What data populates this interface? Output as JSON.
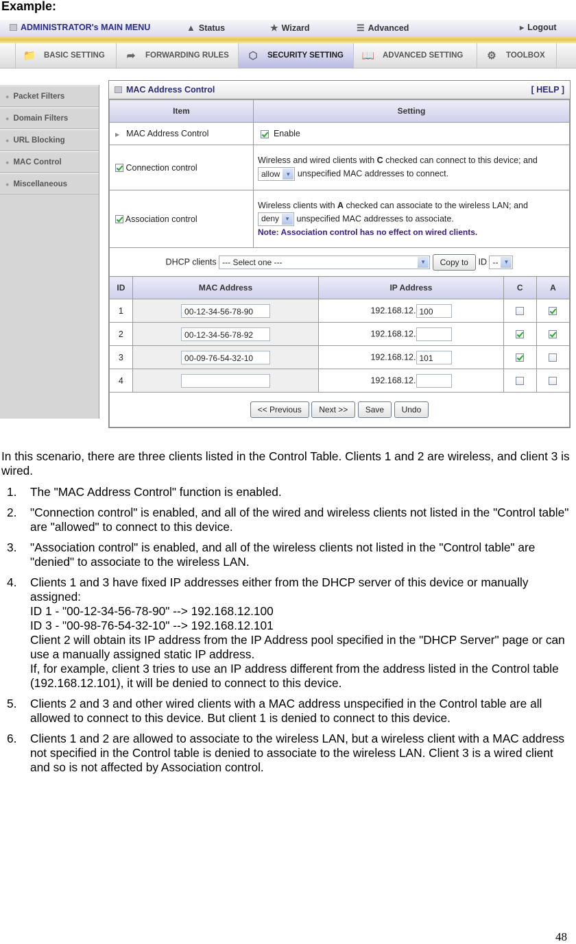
{
  "heading": "Example:",
  "ui": {
    "topbar": {
      "admin_menu": "ADMINISTRATOR's MAIN MENU",
      "items": [
        {
          "label": "Status",
          "icon": "status-icon"
        },
        {
          "label": "Wizard",
          "icon": "wizard-icon"
        },
        {
          "label": "Advanced",
          "icon": "advanced-icon"
        },
        {
          "label": "Logout",
          "icon": "arrow-right-icon"
        }
      ]
    },
    "nav_tabs": [
      {
        "label": "BASIC SETTING",
        "icon": "folder-icon",
        "active": false
      },
      {
        "label": "FORWARDING RULES",
        "icon": "forwarding-icon",
        "active": false
      },
      {
        "label": "SECURITY SETTING",
        "icon": "nut-icon",
        "active": true
      },
      {
        "label": "ADVANCED SETTING",
        "icon": "book-icon",
        "active": false
      },
      {
        "label": "TOOLBOX",
        "icon": "toolbox-icon",
        "active": false
      }
    ],
    "sidebar": {
      "items": [
        {
          "label": "Packet Filters"
        },
        {
          "label": "Domain Filters"
        },
        {
          "label": "URL Blocking"
        },
        {
          "label": "MAC Control"
        },
        {
          "label": "Miscellaneous"
        }
      ]
    },
    "panel": {
      "title": "MAC Address Control",
      "help": "[ HELP ]",
      "headers": {
        "item": "Item",
        "setting": "Setting"
      },
      "mac_control": {
        "label": "MAC Address Control",
        "checkbox_label": "Enable",
        "checked": true
      },
      "connection": {
        "label": "Connection control",
        "checked": true,
        "desc_pre": "Wireless and wired clients with ",
        "desc_bold": "C",
        "desc_post": " checked can connect to this device; and",
        "select_value": "allow",
        "after_select": "unspecified MAC addresses to connect."
      },
      "association": {
        "label": "Association control",
        "checked": true,
        "desc_pre": "Wireless clients with ",
        "desc_bold": "A",
        "desc_post": " checked can associate to the wireless LAN; and",
        "select_value": "deny",
        "after_select": "unspecified MAC addresses to associate.",
        "note": "Note: Association control has no effect on wired clients."
      },
      "dhcp": {
        "label": "DHCP clients",
        "select_value": "--- Select one ---",
        "copy_button": "Copy to",
        "id_label": "ID",
        "id_value": "--"
      },
      "client_table": {
        "headers": [
          "ID",
          "MAC Address",
          "IP Address",
          "C",
          "A"
        ],
        "ip_prefix": "192.168.12.",
        "rows": [
          {
            "id": "1",
            "mac": "00-12-34-56-78-90",
            "ip_last": "100",
            "c": false,
            "a": true
          },
          {
            "id": "2",
            "mac": "00-12-34-56-78-92",
            "ip_last": "",
            "c": true,
            "a": true
          },
          {
            "id": "3",
            "mac": "00-09-76-54-32-10",
            "ip_last": "101",
            "c": true,
            "a": false
          },
          {
            "id": "4",
            "mac": "",
            "ip_last": "",
            "c": false,
            "a": false
          }
        ]
      },
      "buttons": {
        "previous": "<< Previous",
        "next": "Next >>",
        "save": "Save",
        "undo": "Undo"
      }
    }
  },
  "intro": "In this scenario, there are three clients listed in the Control Table. Clients 1 and 2 are wireless, and client 3 is wired.",
  "list": [
    {
      "num": "1.",
      "lines": [
        "The \"MAC Address Control\" function is enabled."
      ]
    },
    {
      "num": "2.",
      "lines": [
        "\"Connection control\" is enabled, and all of the wired and wireless clients not listed in the \"Control table\" are \"allowed\" to connect to this device."
      ]
    },
    {
      "num": "3.",
      "lines": [
        "\"Association control\" is enabled, and all of the wireless clients not listed in the \"Control table\" are \"denied\" to associate to the wireless LAN."
      ]
    },
    {
      "num": "4.",
      "lines": [
        "Clients 1 and 3 have fixed IP addresses either from the DHCP server of this device or manually assigned:",
        "ID 1 - \"00-12-34-56-78-90\" --> 192.168.12.100",
        "ID 3 - \"00-98-76-54-32-10\" --> 192.168.12.101",
        "Client 2 will obtain its IP address from the IP Address pool specified in the \"DHCP Server\" page or can use a manually assigned static IP address.",
        "If, for example, client 3 tries to use an IP address different from the address listed in the Control table (192.168.12.101), it will be denied to connect to this device."
      ]
    },
    {
      "num": "5.",
      "lines": [
        "Clients 2 and 3 and other wired clients with a MAC address unspecified in the Control table are all allowed to connect to this device. But client 1 is denied to connect to this device."
      ]
    },
    {
      "num": "6.",
      "lines": [
        "Clients 1 and 2 are allowed to associate to the wireless LAN, but a wireless client with a MAC address not specified in the Control table is denied to associate to the wireless LAN. Client 3 is a wired client and so is not affected by Association control."
      ]
    }
  ],
  "page_number": "48"
}
